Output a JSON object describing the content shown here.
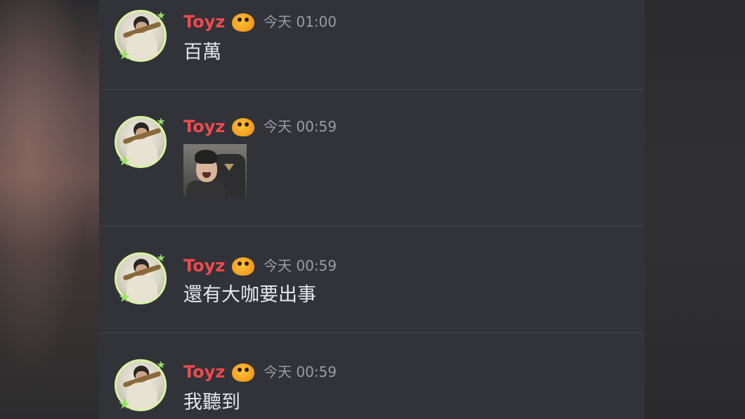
{
  "messages": [
    {
      "author": "Toyz",
      "badge_icon": "duck-emoji-badge",
      "timestamp": "今天 01:00",
      "content": "百萬"
    },
    {
      "author": "Toyz",
      "badge_icon": "duck-emoji-badge",
      "timestamp": "今天 00:59",
      "attachment": "image-thumbnail"
    },
    {
      "author": "Toyz",
      "badge_icon": "duck-emoji-badge",
      "timestamp": "今天 00:59",
      "content": "還有大咖要出事"
    },
    {
      "author": "Toyz",
      "badge_icon": "duck-emoji-badge",
      "timestamp": "今天 00:59",
      "content": "我聽到"
    }
  ],
  "colors": {
    "chat_background": "#313338",
    "username": "#ec4a4f",
    "timestamp": "#9b9ca3",
    "message_text": "#e6e7ea",
    "avatar_ring": "#d9f2a5"
  }
}
